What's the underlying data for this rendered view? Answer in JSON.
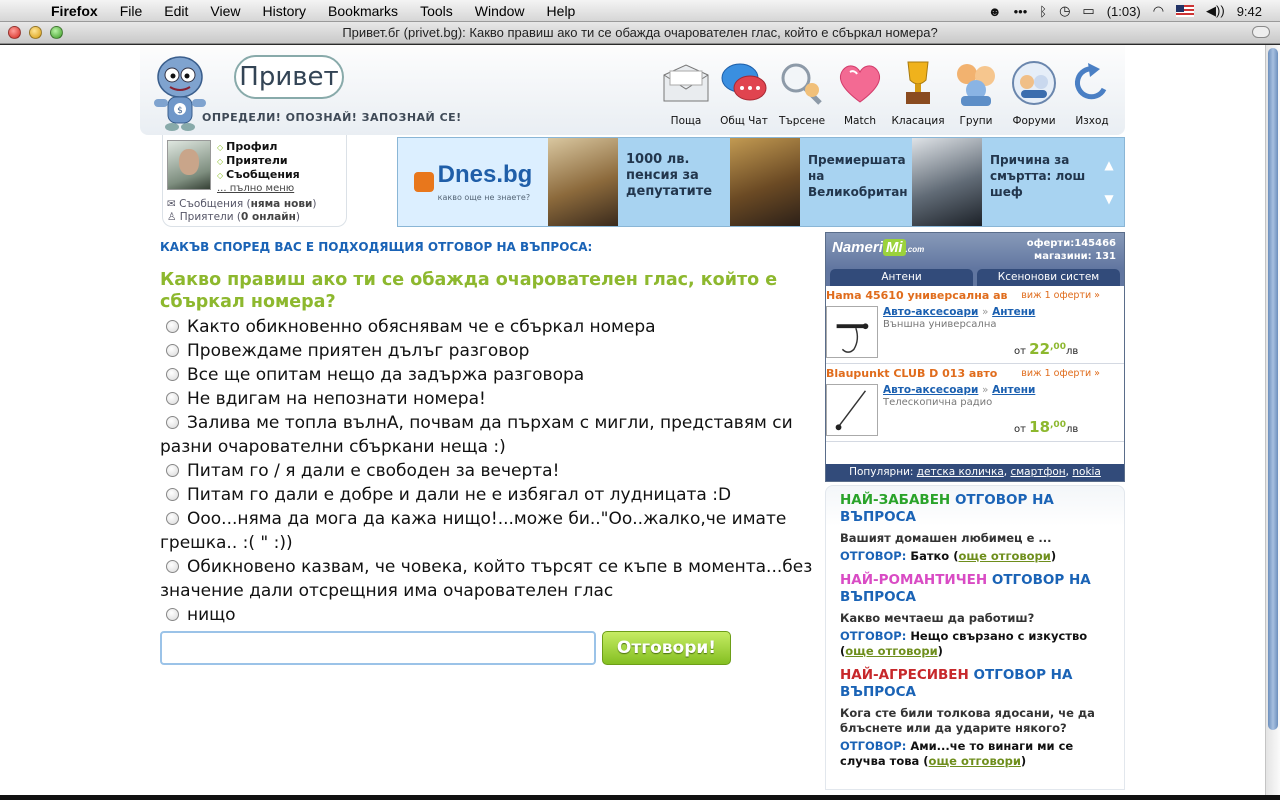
{
  "os_menu": {
    "app": "Firefox",
    "items": [
      "File",
      "Edit",
      "View",
      "History",
      "Bookmarks",
      "Tools",
      "Window",
      "Help"
    ],
    "battery": "(1:03)",
    "time": "9:42"
  },
  "window": {
    "title": "Привет.бг (privet.bg): Какво правиш ако ти се обажда очарователен глас, който е сбъркал номера?"
  },
  "site": {
    "logo_text": "Привет",
    "tagline": "ОПРЕДЕЛИ! ОПОЗНАЙ! ЗАПОЗНАЙ СЕ!",
    "nav": [
      {
        "label": "Поща",
        "icon": "mail-icon"
      },
      {
        "label": "Общ Чат",
        "icon": "chat-icon"
      },
      {
        "label": "Търсене",
        "icon": "search-icon"
      },
      {
        "label": "Match",
        "icon": "heart-icon"
      },
      {
        "label": "Класация",
        "icon": "trophy-icon"
      },
      {
        "label": "Групи",
        "icon": "group-icon"
      },
      {
        "label": "Форуми",
        "icon": "forum-icon"
      },
      {
        "label": "Изход",
        "icon": "exit-icon"
      }
    ]
  },
  "profile": {
    "links": [
      "Профил",
      "Приятели",
      "Съобщения"
    ],
    "full_menu": "... пълно меню",
    "messages_label": "Съобщения",
    "messages_value": "няма нови",
    "friends_label": "Приятели",
    "friends_value": "0 онлайн"
  },
  "banner": {
    "logo": "Dnes.bg",
    "logo_sub": "какво още не знаете?",
    "news": [
      "1000 лв. пенсия за депутатите",
      "Премиершата на Великобритан",
      "Причина за смъртта: лош шеф"
    ]
  },
  "question": {
    "heading": "КАКЪВ СПОРЕД ВАС Е ПОДХОДЯЩИЯ ОТГОВОР НА ВЪПРОСА",
    "title": "Какво правиш ако ти се обажда очарователен глас, който е сбъркал номера?",
    "answers": [
      "Както обикновенно обяснявам че е сбъркал номера",
      "Провеждаме приятен дълъг разговор",
      "Все ще опитам нещо да задържа разговора",
      "Не вдигам на непознати номера!",
      "Залива ме топла вълнА, почвам да пърхам с мигли, представям си разни очарователни сбъркани неща :)",
      "Питам го / я дали е свободен за вечерта!",
      "Питам го дали е добре и дали не е избягал от лудницата :D",
      "Ооо...няма да мога да кажа нищо!...може би..\"Оо..жалко,че имате грешка.. :( \" :))",
      "Обикновено казвам, че човека, който търсят се къпе в момента...без значение дали отсрещния има очарователен глас",
      "нищо"
    ],
    "input_value": "",
    "submit_label": "Отговори!"
  },
  "nameri": {
    "logo_a": "Nameri",
    "logo_b": "Mi",
    "logo_c": ".com",
    "offers": "оферти:145466",
    "shops": "магазини:   131",
    "tabs": [
      "Антени",
      "Ксенонови систем"
    ],
    "products": [
      {
        "name": "Hama 45610 универсална ав",
        "offers": "виж 1 оферти »",
        "cat": "Авто-аксесоари",
        "subcat": "Антени",
        "desc": "Външна универсална",
        "price_prefix": "от",
        "price_int": "22",
        "price_dec": ",00",
        "currency": "лв"
      },
      {
        "name": "Blaupunkt CLUB D 013 авто",
        "offers": "виж 1 оферти »",
        "cat": "Авто-аксесоари",
        "subcat": "Антени",
        "desc": "Телескопична радио",
        "price_prefix": "от",
        "price_int": "18",
        "price_dec": ",00",
        "currency": "лв"
      }
    ],
    "popular_label": "Популярни:",
    "popular": [
      "детска количка",
      "смартфон",
      "nokia"
    ]
  },
  "best": [
    {
      "h1": "НАЙ-ЗАБАВЕН",
      "h2": "ОТГОВОР НА ВЪПРОСА",
      "q": "Вашият домашен любимец е ...",
      "a_label": "ОТГОВОР:",
      "a": "Батко",
      "more": "още отговори"
    },
    {
      "h1": "НАЙ-РОМАНТИЧЕН",
      "h2": "ОТГОВОР НА ВЪПРОСА",
      "q": "Какво мечтаеш да работиш?",
      "a_label": "ОТГОВОР:",
      "a": "Нещо свързано с изкуство",
      "more": "още отговори"
    },
    {
      "h1": "НАЙ-АГРЕСИВЕН",
      "h2": "ОТГОВОР НА ВЪПРОСА",
      "q": "Кога сте били толкова ядосани, че да блъснете или да ударите някого?",
      "a_label": "ОТГОВОР:",
      "a": "Ами...че то винаги ми се случва това",
      "more": "още отговори"
    }
  ]
}
